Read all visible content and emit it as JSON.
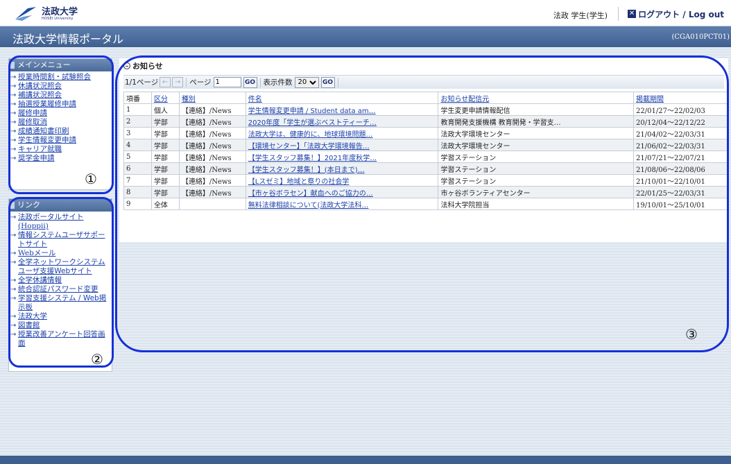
{
  "header": {
    "logo_name": "法政大学",
    "logo_sub": "HOSEI University",
    "user_label": "法政 学生(学生)",
    "logout_label": "ログアウト / Log out"
  },
  "titlebar": {
    "title": "法政大学情報ポータル",
    "code": "(CGA010PCT01)"
  },
  "main_menu": {
    "title": "メインメニュー",
    "items": [
      "授業時間割・試験照会",
      "休講状況照会",
      "補講状況照会",
      "抽選授業履修申請",
      "履修申請",
      "履修取消",
      "成績通知書印刷",
      "学生情報変更申請",
      "キャリア就職",
      "奨学金申請"
    ]
  },
  "links": {
    "title": "リンク",
    "items": [
      "法政ポータルサイト(Hoppii)",
      "情報システムユーザサポートサイト",
      "Webメール",
      "全学ネットワークシステム ユーザ支援Webサイト",
      "全学休講情報",
      "統合認証パスワード変更",
      "学習支援システム / Web掲示板",
      "法政大学",
      "図書館",
      "授業改善アンケート回答画面"
    ]
  },
  "notices": {
    "heading": "お知らせ",
    "pager": {
      "page_info": "1/1ページ",
      "page_label": "ページ",
      "page_value": "1",
      "go_label": "GO",
      "count_label": "表示件数",
      "count_value": "20"
    },
    "columns": [
      "項番",
      "区分",
      "種別",
      "件名",
      "お知らせ配信元",
      "掲載期間"
    ],
    "rows": [
      {
        "no": "1",
        "cat": "個人",
        "type": "【連絡】/News",
        "subject": "学生情報変更申請 / Student data am…",
        "sender": "学生変更申請情報配信",
        "period": "22/01/27～22/02/03"
      },
      {
        "no": "2",
        "cat": "学部",
        "type": "【連絡】/News",
        "subject": "2020年度「学生が選ぶベストティーチ…",
        "sender": "教育開発支援機構 教育開発・学習支…",
        "period": "20/12/04～22/12/22"
      },
      {
        "no": "3",
        "cat": "学部",
        "type": "【連絡】/News",
        "subject": "法政大学は、健康的に、地球環境問題…",
        "sender": "法政大学環境センター",
        "period": "21/04/02～22/03/31"
      },
      {
        "no": "4",
        "cat": "学部",
        "type": "【連絡】/News",
        "subject": "【環境センター】「法政大学環境報告…",
        "sender": "法政大学環境センター",
        "period": "21/06/02～22/03/31"
      },
      {
        "no": "5",
        "cat": "学部",
        "type": "【連絡】/News",
        "subject": "【学生スタッフ募集！】2021年度秋学…",
        "sender": "学習ステーション",
        "period": "21/07/21～22/07/21"
      },
      {
        "no": "6",
        "cat": "学部",
        "type": "【連絡】/News",
        "subject": "【学生スタッフ募集！】(本日まで)…",
        "sender": "学習ステーション",
        "period": "21/08/06～22/08/06"
      },
      {
        "no": "7",
        "cat": "学部",
        "type": "【連絡】/News",
        "subject": "【Lスゼミ】地域と祭りの社会学",
        "sender": "学習ステーション",
        "period": "21/10/01～22/10/01"
      },
      {
        "no": "8",
        "cat": "学部",
        "type": "【連絡】/News",
        "subject": "【市ヶ谷ボラセン】献血へのご協力の…",
        "sender": "市ヶ谷ボランティアセンター",
        "period": "22/01/25～22/03/31"
      },
      {
        "no": "9",
        "cat": "全体",
        "type": "",
        "subject": "無料法律相談について(法政大学法科…",
        "sender": "法科大学院担当",
        "period": "19/10/01～25/10/01"
      }
    ]
  },
  "annotations": {
    "one": "①",
    "two": "②",
    "three": "③"
  },
  "colors": {
    "brand": "#1d2f6e",
    "titlebar": "#3e5f8f",
    "annotation": "#1530d6"
  }
}
